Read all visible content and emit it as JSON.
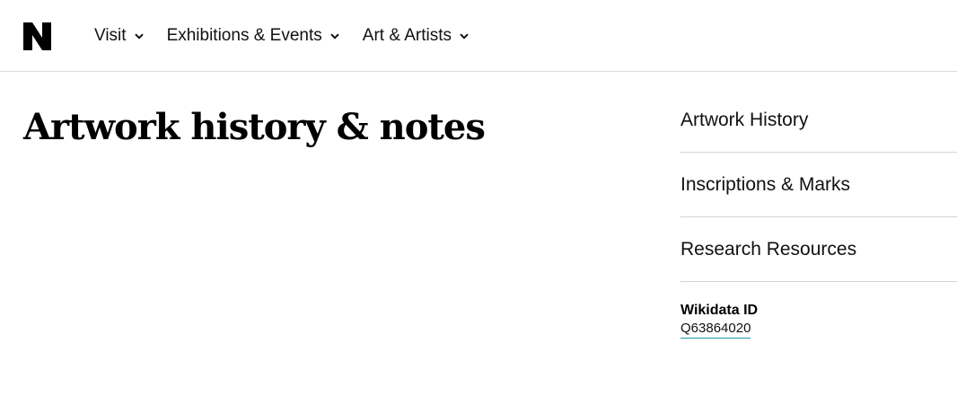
{
  "logo": {
    "icon": "n-logo-icon",
    "color": "#000000"
  },
  "nav": {
    "items": [
      {
        "label": "Visit"
      },
      {
        "label": "Exhibitions & Events"
      },
      {
        "label": "Art & Artists"
      }
    ]
  },
  "main": {
    "title": "Artwork history & notes"
  },
  "sidebar": {
    "links": [
      {
        "label": "Artwork History"
      },
      {
        "label": "Inscriptions & Marks"
      },
      {
        "label": "Research Resources"
      }
    ],
    "wikidata": {
      "label": "Wikidata ID",
      "value": "Q63864020",
      "link_underline_color": "#1a9aa0"
    }
  }
}
